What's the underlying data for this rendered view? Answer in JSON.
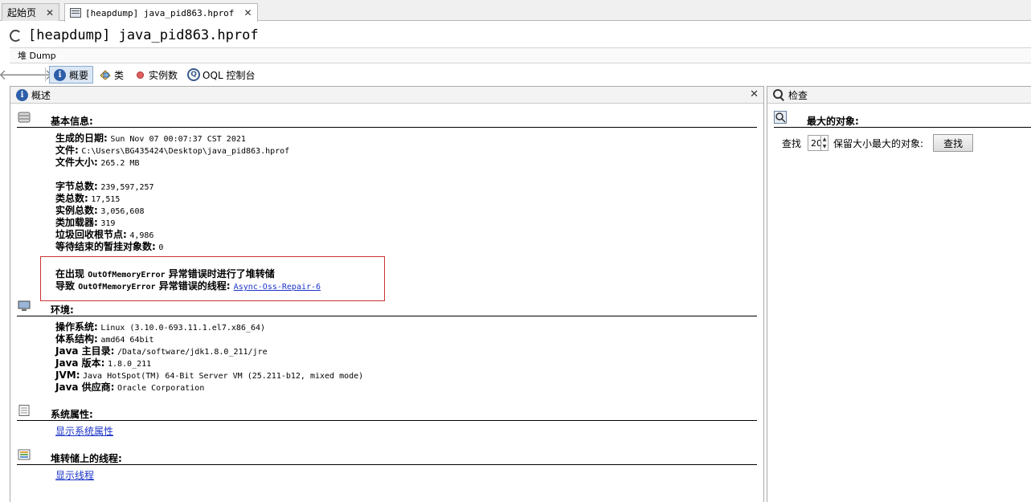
{
  "tabs": [
    {
      "label": "起始页",
      "active": false
    },
    {
      "label": "[heapdump] java_pid863.hprof",
      "active": true
    }
  ],
  "title": "[heapdump] java_pid863.hprof",
  "subtab": "堆 Dump",
  "toolbar": {
    "summary": "概要",
    "classes": "类",
    "instances": "实例数",
    "oql": "OQL 控制台"
  },
  "left_panel": {
    "title": "概述",
    "basic": {
      "heading": "基本信息:",
      "date_k": "生成的日期:",
      "date_v": "Sun Nov 07 00:07:37 CST 2021",
      "file_k": "文件:",
      "file_v": "C:\\Users\\BG435424\\Desktop\\java_pid863.hprof",
      "size_k": "文件大小:",
      "size_v": "265.2 MB",
      "bytes_k": "字节总数:",
      "bytes_v": "239,597,257",
      "classes_k": "类总数:",
      "classes_v": "17,515",
      "inst_k": "实例总数:",
      "inst_v": "3,056,608",
      "loaders_k": "类加载器:",
      "loaders_v": "319",
      "gcroots_k": "垃圾回收根节点:",
      "gcroots_v": "4,986",
      "pending_k": "等待结束的暂挂对象数:",
      "pending_v": "0"
    },
    "oom": {
      "line1_pre": "在出现 ",
      "line1_err": "OutOfMemoryError",
      "line1_post": " 异常错误时进行了堆转储",
      "line2_pre": "导致 ",
      "line2_err": "OutOfMemoryError",
      "line2_post": " 异常错误的线程: ",
      "thread": "Async-Oss-Repair-6"
    },
    "env": {
      "heading": "环境:",
      "os_k": "操作系统:",
      "os_v": "Linux (3.10.0-693.11.1.el7.x86_64)",
      "arch_k": "体系结构:",
      "arch_v": "amd64 64bit",
      "home_k": "Java 主目录:",
      "home_v": "/Data/software/jdk1.8.0_211/jre",
      "ver_k": "Java 版本:",
      "ver_v": "1.8.0_211",
      "jvm_k": "JVM:",
      "jvm_v": "Java HotSpot(TM) 64-Bit Server VM (25.211-b12, mixed mode)",
      "vendor_k": "Java 供应商:",
      "vendor_v": "Oracle Corporation"
    },
    "sysprops": {
      "heading": "系统属性:",
      "link": "显示系统属性"
    },
    "threads": {
      "heading": "堆转储上的线程:",
      "link": "显示线程"
    }
  },
  "right_panel": {
    "title": "检查",
    "heading": "最大的对象:",
    "find_label": "查找",
    "count": "20",
    "retain_label": "保留大小最大的对象:",
    "button": "查找"
  },
  "icons": [
    "close-icon",
    "heapdump-tab-icon",
    "loading-spinner-icon",
    "back-arrow-icon",
    "forward-arrow-icon",
    "info-icon",
    "class-icon",
    "instance-dot-icon",
    "oql-icon",
    "database-icon",
    "computer-icon",
    "document-icon",
    "threads-icon",
    "search-icon"
  ]
}
